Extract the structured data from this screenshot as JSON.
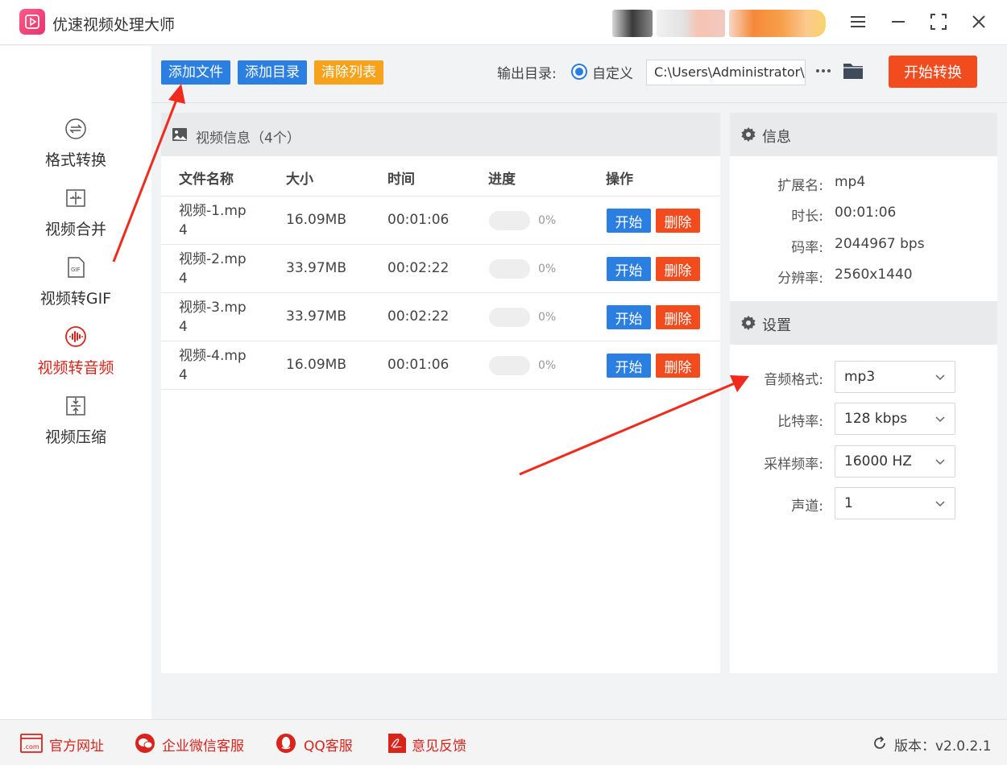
{
  "app": {
    "title": "优速视频处理大师"
  },
  "sidebar": {
    "items": [
      {
        "label": "格式转换",
        "icon": "format-convert-icon",
        "active": false
      },
      {
        "label": "视频合并",
        "icon": "video-merge-icon",
        "active": false
      },
      {
        "label": "视频转GIF",
        "icon": "gif-icon",
        "active": false
      },
      {
        "label": "视频转音频",
        "icon": "audio-wave-icon",
        "active": true
      },
      {
        "label": "视频压缩",
        "icon": "compress-icon",
        "active": false
      }
    ]
  },
  "toolbar": {
    "add_file": "添加文件",
    "add_dir": "添加目录",
    "clear_list": "清除列表",
    "output_label": "输出目录:",
    "custom_label": "自定义",
    "output_path": "C:\\Users\\Administrator\\",
    "start_convert": "开始转换"
  },
  "list": {
    "title": "视频信息（4个）",
    "columns": [
      "文件名称",
      "大小",
      "时间",
      "进度",
      "操作"
    ],
    "start_label": "开始",
    "delete_label": "删除",
    "rows": [
      {
        "name": "视频-1.mp4",
        "size": "16.09MB",
        "time": "00:01:06",
        "progress": "0%"
      },
      {
        "name": "视频-2.mp4",
        "size": "33.97MB",
        "time": "00:02:22",
        "progress": "0%"
      },
      {
        "name": "视频-3.mp4",
        "size": "33.97MB",
        "time": "00:02:22",
        "progress": "0%"
      },
      {
        "name": "视频-4.mp4",
        "size": "16.09MB",
        "time": "00:01:06",
        "progress": "0%"
      }
    ]
  },
  "info": {
    "title": "信息",
    "rows": [
      {
        "label": "扩展名:",
        "value": "mp4"
      },
      {
        "label": "时长:",
        "value": "00:01:06"
      },
      {
        "label": "码率:",
        "value": "2044967 bps"
      },
      {
        "label": "分辨率:",
        "value": "2560x1440"
      }
    ]
  },
  "settings": {
    "title": "设置",
    "rows": [
      {
        "label": "音频格式:",
        "value": "mp3"
      },
      {
        "label": "比特率:",
        "value": "128 kbps"
      },
      {
        "label": "采样频率:",
        "value": "16000 HZ"
      },
      {
        "label": "声道:",
        "value": "1"
      }
    ]
  },
  "footer": {
    "website": "官方网址",
    "wechat": "企业微信客服",
    "qq": "QQ客服",
    "feedback": "意见反馈",
    "version": "版本：v2.0.2.1"
  },
  "colors": {
    "blue": "#2b7fe0",
    "orange": "#f7a21b",
    "red": "#f24b1e",
    "active": "#d9241c"
  }
}
